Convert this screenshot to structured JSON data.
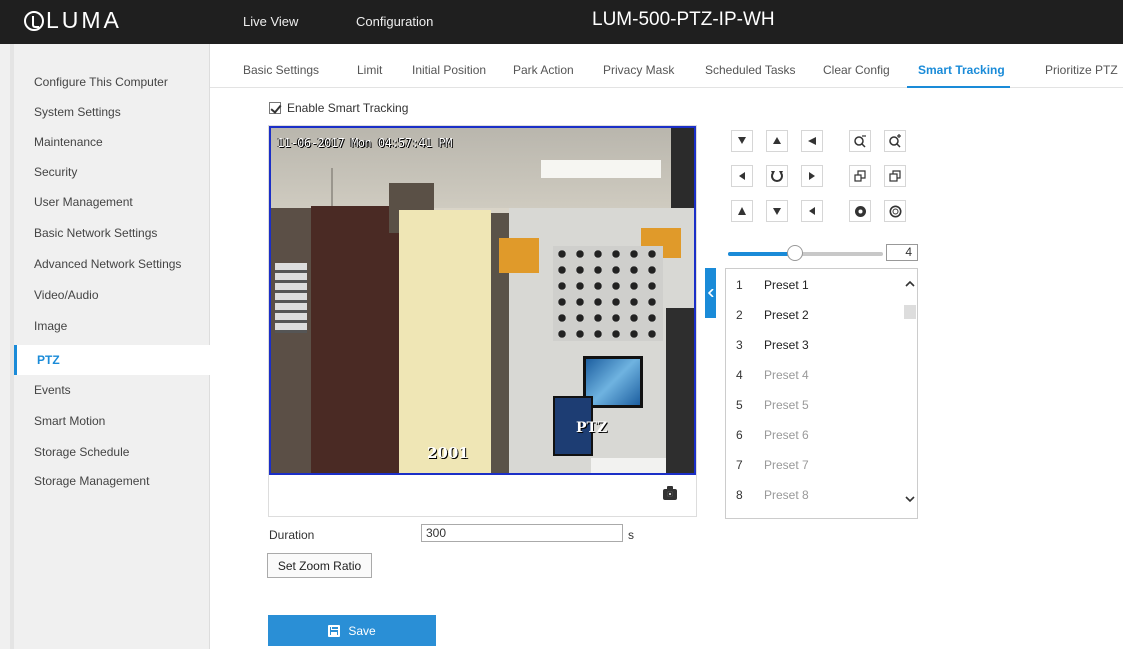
{
  "header": {
    "logo": "LUMA",
    "nav": [
      "Live View",
      "Configuration"
    ],
    "device_name": "LUM-500-PTZ-IP-WH"
  },
  "sidebar": {
    "items": [
      "Configure This Computer",
      "System Settings",
      "Maintenance",
      "Security",
      "User Management",
      "Basic Network Settings",
      "Advanced Network Settings",
      "Video/Audio",
      "Image",
      "PTZ",
      "Events",
      "Smart Motion",
      "Storage Schedule",
      "Storage Management"
    ],
    "active": "PTZ"
  },
  "tabs": {
    "items": [
      "Basic Settings",
      "Limit",
      "Initial Position",
      "Park Action",
      "Privacy Mask",
      "Scheduled Tasks",
      "Clear Config",
      "Smart Tracking",
      "Prioritize PTZ"
    ],
    "active": "Smart Tracking"
  },
  "smart_tracking": {
    "enable_label": "Enable Smart Tracking",
    "enabled": true
  },
  "video": {
    "osd_datetime": "11-06-2017 Mon 04:57:41 PM",
    "osd_camera": "2001",
    "scene_label": "PTZ",
    "snapshot_icon": "camera-icon"
  },
  "ptz": {
    "speed_value": "4",
    "speed_level": 0.43,
    "buttons": [
      {
        "name": "pan-up-left-button",
        "icon": "arrow-up-left"
      },
      {
        "name": "pan-up-button",
        "icon": "arrow-up"
      },
      {
        "name": "pan-up-right-button",
        "icon": "arrow-up-right"
      },
      {
        "name": "zoom-in-button",
        "icon": "zoom-in-icon"
      },
      {
        "name": "zoom-out-button",
        "icon": "zoom-out-icon"
      },
      {
        "name": "pan-left-button",
        "icon": "arrow-left"
      },
      {
        "name": "auto-pan-button",
        "icon": "rotate-icon"
      },
      {
        "name": "pan-right-button",
        "icon": "arrow-right"
      },
      {
        "name": "focus-near-button",
        "icon": "focus-near-icon"
      },
      {
        "name": "focus-far-button",
        "icon": "focus-far-icon"
      },
      {
        "name": "pan-down-left-button",
        "icon": "arrow-down-left"
      },
      {
        "name": "pan-down-button",
        "icon": "arrow-down"
      },
      {
        "name": "pan-down-right-button",
        "icon": "arrow-down-right"
      },
      {
        "name": "iris-open-button",
        "icon": "iris-open-icon"
      },
      {
        "name": "iris-close-button",
        "icon": "iris-close-icon"
      }
    ]
  },
  "presets": [
    {
      "num": "1",
      "name": "Preset 1",
      "defined": true
    },
    {
      "num": "2",
      "name": "Preset 2",
      "defined": true
    },
    {
      "num": "3",
      "name": "Preset 3",
      "defined": true
    },
    {
      "num": "4",
      "name": "Preset 4",
      "defined": false
    },
    {
      "num": "5",
      "name": "Preset 5",
      "defined": false
    },
    {
      "num": "6",
      "name": "Preset 6",
      "defined": false
    },
    {
      "num": "7",
      "name": "Preset 7",
      "defined": false
    },
    {
      "num": "8",
      "name": "Preset 8",
      "defined": false
    }
  ],
  "form": {
    "duration_label": "Duration",
    "duration_value": "300",
    "duration_unit": "s",
    "zoom_ratio_label": "Set Zoom Ratio",
    "save_label": "Save"
  },
  "colors": {
    "accent": "#1a8bd8",
    "topbar": "#1f1f1f",
    "video_border": "#1b2fc7"
  }
}
